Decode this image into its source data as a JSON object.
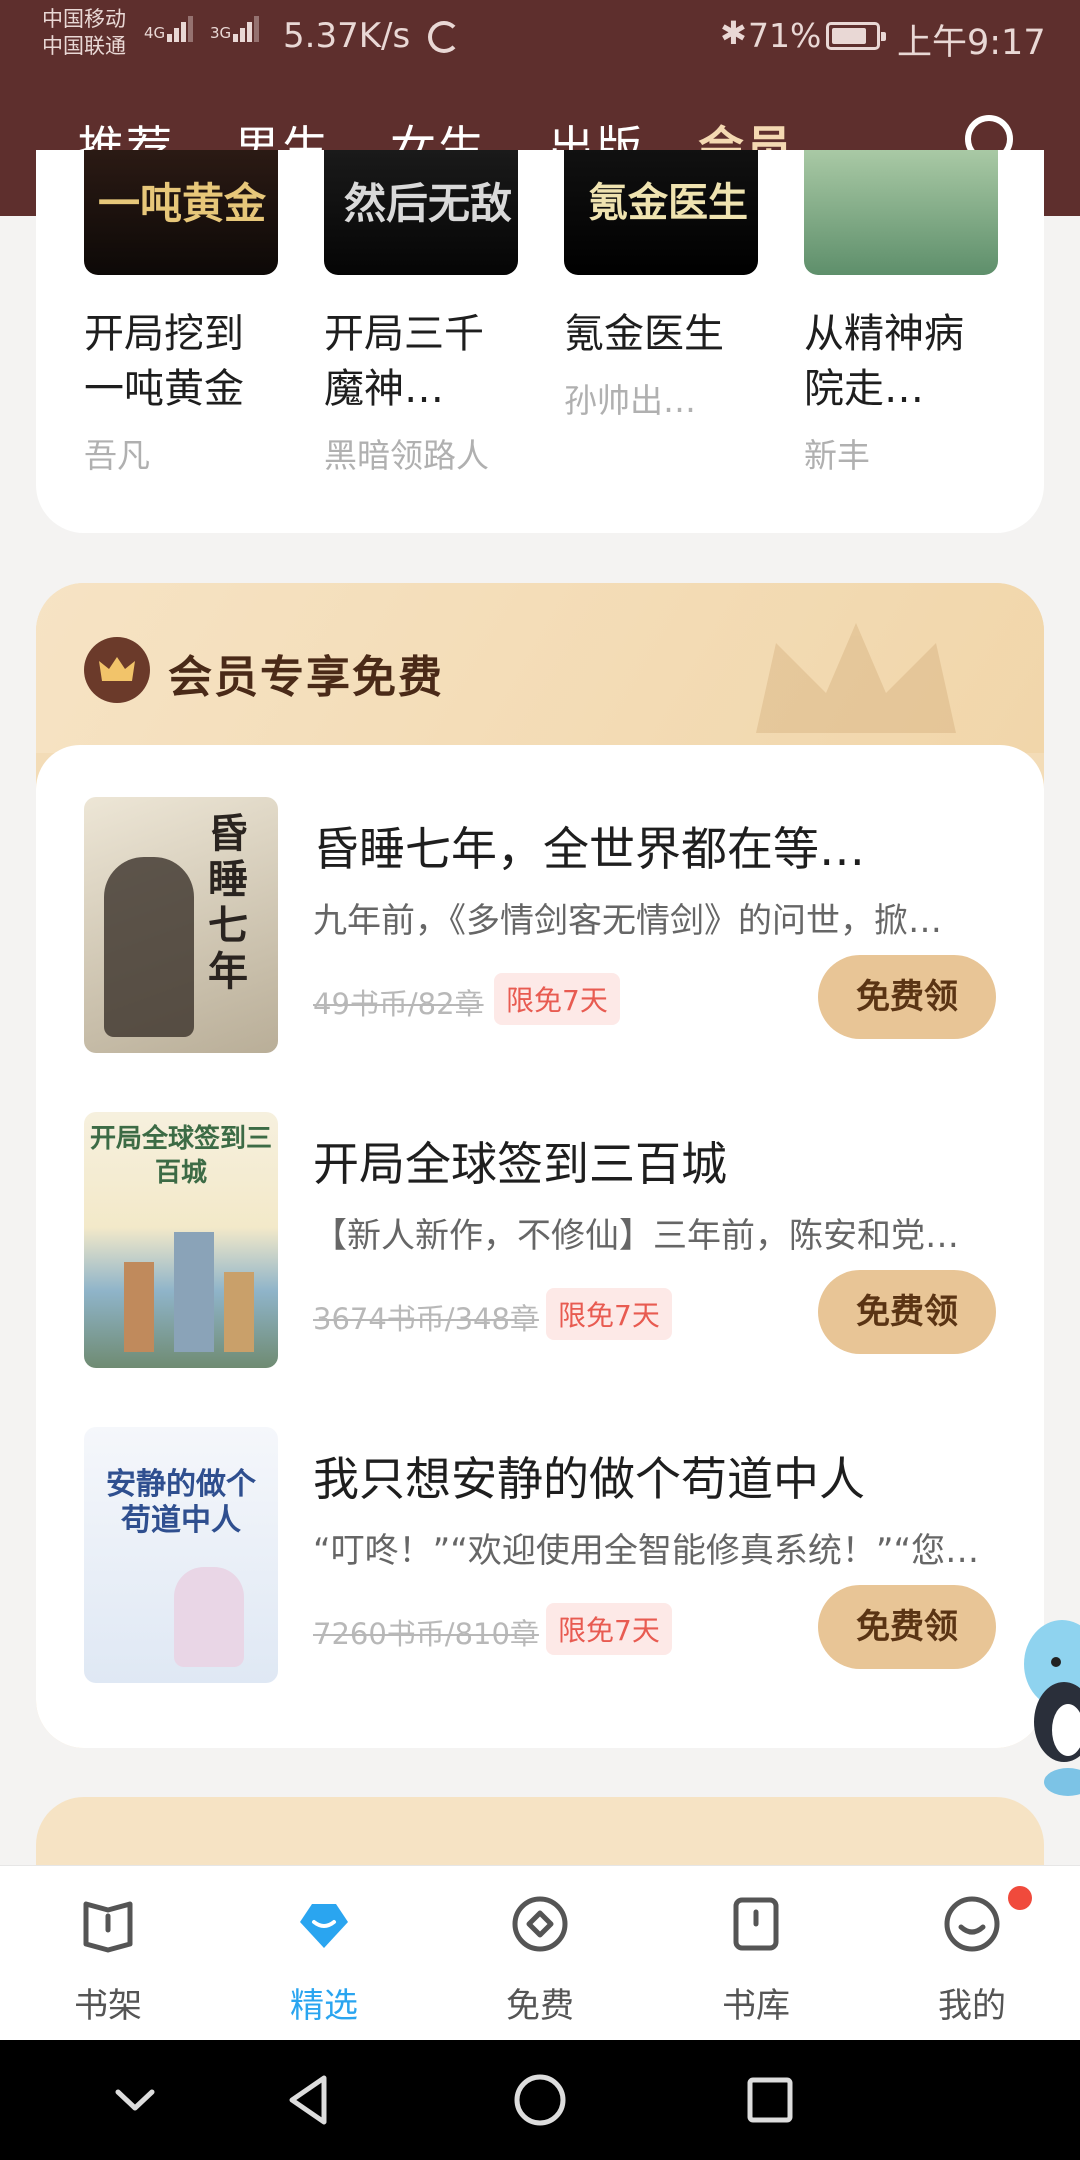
{
  "status": {
    "carrier1": "中国移动",
    "carrier2": "中国联通",
    "sig1_label": "4G",
    "sig2_label": "3G",
    "speed": "5.37K/s",
    "battery": "71%",
    "time": "上午9:17"
  },
  "tabs": [
    "推荐",
    "男生",
    "女生",
    "出版",
    "会员"
  ],
  "active_tab": "会员",
  "top_books": [
    {
      "cover_text": "一吨黄金",
      "title1": "开局挖到",
      "title2": "一吨黄金",
      "author": "吾凡"
    },
    {
      "cover_text": "然后无敌",
      "title1": "开局三千",
      "title2": "魔神…",
      "author": "黑暗领路人"
    },
    {
      "cover_text": "氪金医生",
      "title1": "氪金医生",
      "title2": "",
      "author": "孙帅出…"
    },
    {
      "cover_text": "",
      "title1": "从精神病",
      "title2": "院走…",
      "author": "新丰"
    }
  ],
  "member_section": {
    "title": "会员专享免费",
    "books": [
      {
        "cover_text": "昏睡七年",
        "title": "昏睡七年，全世界都在等…",
        "desc": "九年前，《多情剑客无情剑》的问世，掀…",
        "price": "49书币/82章",
        "tag": "限免7天",
        "button": "免费领"
      },
      {
        "cover_text": "开局全球签到三百城",
        "title": "开局全球签到三百城",
        "desc": "【新人新作，不修仙】三年前，陈安和党…",
        "price": "3674书币/348章",
        "tag": "限免7天",
        "button": "免费领"
      },
      {
        "cover_text": "安静的做个苟道中人",
        "title": "我只想安静的做个苟道中人",
        "desc": "“叮咚！”“欢迎使用全智能修真系统！”“您…",
        "price": "7260书币/810章",
        "tag": "限免7天",
        "button": "免费领"
      }
    ]
  },
  "bottom_nav": [
    {
      "label": "书架",
      "icon": "bookshelf-icon"
    },
    {
      "label": "精选",
      "icon": "featured-icon"
    },
    {
      "label": "免费",
      "icon": "free-icon"
    },
    {
      "label": "书库",
      "icon": "library-icon"
    },
    {
      "label": "我的",
      "icon": "profile-icon"
    }
  ],
  "colors": {
    "header_bg": "#5e2f2d",
    "active_tab": "#f4d9b2",
    "accent_blue": "#2aa5f0",
    "gold_button": "#e8c596",
    "tag_red": "#e85b51"
  }
}
